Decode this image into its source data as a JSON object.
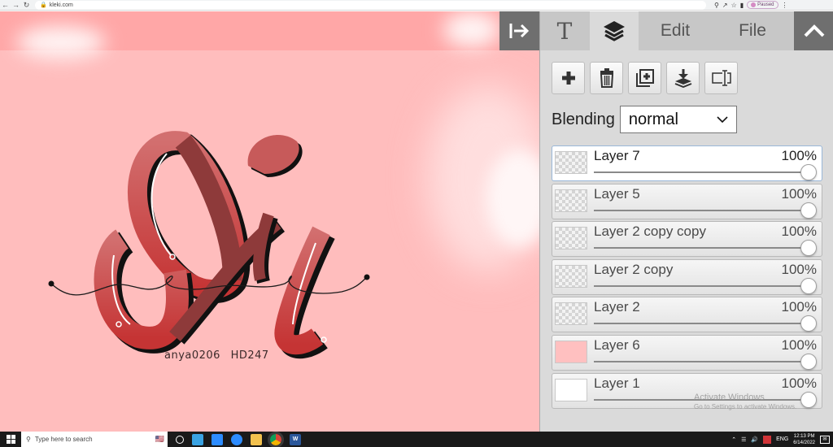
{
  "browser": {
    "url": "kleki.com",
    "profile_status": "Paused",
    "nav_icons": [
      "back-icon",
      "forward-icon",
      "reload-icon"
    ]
  },
  "canvas": {
    "signature": "anya0206   HD247",
    "background_color": "#ffbdbd",
    "band_color": "#ffa7a7",
    "art_colors": {
      "letter_fill": "#c75a5a",
      "letter_dark": "#8e3a3a",
      "outline": "#111111",
      "highlight": "#ffffff"
    }
  },
  "panel": {
    "tabs": [
      {
        "id": "text",
        "label": "T",
        "active": false
      },
      {
        "id": "layers",
        "label": "",
        "active": true
      },
      {
        "id": "edit",
        "label": "Edit",
        "active": false
      },
      {
        "id": "file",
        "label": "File",
        "active": false
      }
    ],
    "tools": [
      {
        "name": "add-layer-button",
        "icon": "plus-icon"
      },
      {
        "name": "delete-layer-button",
        "icon": "trash-icon"
      },
      {
        "name": "duplicate-layer-button",
        "icon": "duplicate-icon"
      },
      {
        "name": "merge-layer-button",
        "icon": "merge-down-icon"
      },
      {
        "name": "rename-layer-button",
        "icon": "rename-icon"
      }
    ],
    "blending": {
      "label": "Blending",
      "value": "normal"
    },
    "layers": [
      {
        "name": "Layer 7",
        "opacity": "100%",
        "opacity_value": 1.0,
        "selected": true,
        "thumb": "checker"
      },
      {
        "name": "Layer 5",
        "opacity": "100%",
        "opacity_value": 1.0,
        "selected": false,
        "thumb": "checker"
      },
      {
        "name": "Layer 2 copy copy",
        "opacity": "100%",
        "opacity_value": 1.0,
        "selected": false,
        "thumb": "checker"
      },
      {
        "name": "Layer 2 copy",
        "opacity": "100%",
        "opacity_value": 1.0,
        "selected": false,
        "thumb": "checker"
      },
      {
        "name": "Layer 2",
        "opacity": "100%",
        "opacity_value": 1.0,
        "selected": false,
        "thumb": "checker"
      },
      {
        "name": "Layer 6",
        "opacity": "100%",
        "opacity_value": 1.0,
        "selected": false,
        "thumb": "pink"
      },
      {
        "name": "Layer 1",
        "opacity": "100%",
        "opacity_value": 1.0,
        "selected": false,
        "thumb": "white"
      }
    ]
  },
  "watermark": {
    "title": "Activate Windows",
    "subtitle": "Go to Settings to activate Windows."
  },
  "taskbar": {
    "search_placeholder": "Type here to search",
    "apps": [
      "task-view-icon",
      "edge-icon",
      "zoom-icon",
      "zoom-meetings-icon",
      "file-explorer-icon",
      "chrome-icon",
      "word-icon"
    ],
    "language": "ENG",
    "time": "12:13 PM",
    "date": "6/14/2022"
  }
}
